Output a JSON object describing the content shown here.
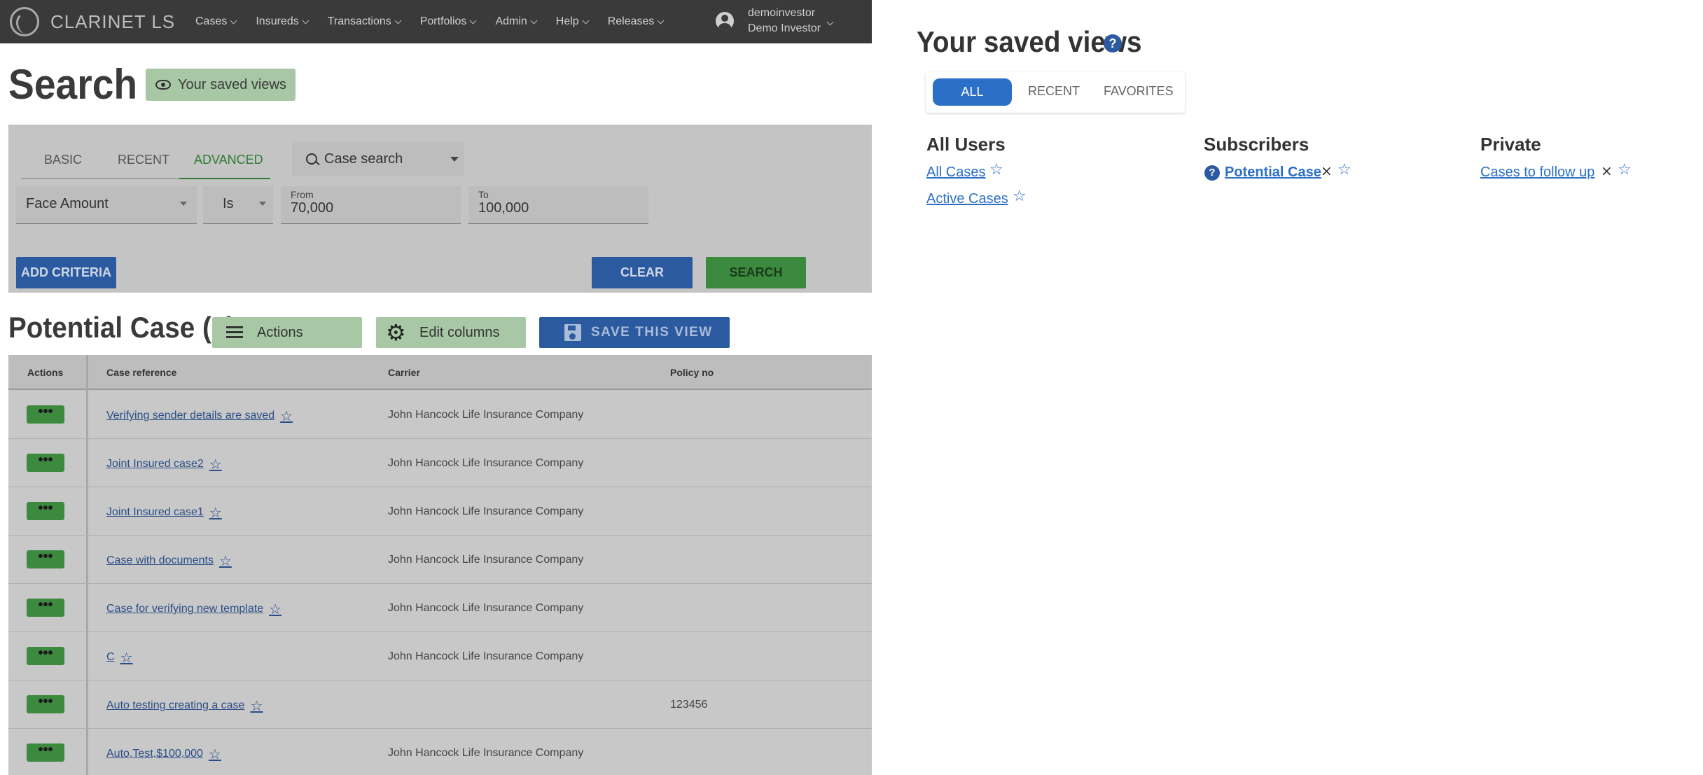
{
  "navbar": {
    "brand": "CLARINET LS",
    "items": [
      "Cases",
      "Insureds",
      "Transactions",
      "Portfolios",
      "Admin",
      "Help",
      "Releases"
    ],
    "user": {
      "username": "demoinvestor",
      "display_name": "Demo Investor"
    }
  },
  "search": {
    "title": "Search",
    "saved_views_label": "Your saved views",
    "tabs": [
      "BASIC",
      "RECENT",
      "ADVANCED"
    ],
    "case_search_label": "Case search",
    "criteria": {
      "field": "Face Amount",
      "operator": "Is",
      "from_label": "From",
      "from_value": "70,000",
      "to_label": "To",
      "to_value": "100,000"
    },
    "add_criteria_label": "ADD CRITERIA",
    "clear_label": "CLEAR",
    "search_label": "SEARCH"
  },
  "results": {
    "title": "Potential Case (8)",
    "actions_label": "Actions",
    "edit_columns_label": "Edit columns",
    "save_view_label": "SAVE THIS VIEW",
    "columns": [
      "Actions",
      "Case reference",
      "Carrier",
      "Policy no"
    ],
    "row_button": "•••",
    "rows": [
      {
        "ref": "Verifying sender details are saved",
        "carrier": "John Hancock Life Insurance Company",
        "policy": ""
      },
      {
        "ref": "Joint Insured case2",
        "carrier": "John Hancock Life Insurance Company",
        "policy": ""
      },
      {
        "ref": "Joint Insured case1",
        "carrier": "John Hancock Life Insurance Company",
        "policy": ""
      },
      {
        "ref": "Case with documents",
        "carrier": "John Hancock Life Insurance Company",
        "policy": ""
      },
      {
        "ref": "Case for verifying new template",
        "carrier": "John Hancock Life Insurance Company",
        "policy": ""
      },
      {
        "ref": "C",
        "carrier": "John Hancock Life Insurance Company",
        "policy": ""
      },
      {
        "ref": "Auto testing creating a case",
        "carrier": "",
        "policy": "123456"
      },
      {
        "ref": "Auto,Test,$100,000",
        "carrier": "John Hancock Life Insurance Company",
        "policy": ""
      }
    ]
  },
  "saved_views_panel": {
    "title": "Your saved views",
    "tabs": [
      "ALL",
      "RECENT",
      "FAVORITES"
    ],
    "columns": [
      {
        "heading": "All Users",
        "views": [
          "All Cases",
          "Active Cases"
        ]
      },
      {
        "heading": "Subscribers",
        "views": [
          "Potential Case"
        ]
      },
      {
        "heading": "Private",
        "views": [
          "Cases to follow up"
        ]
      }
    ]
  },
  "icons": {
    "star": "☆",
    "close": "×",
    "help": "?"
  },
  "colors": {
    "primary_blue": "#2c6fc9",
    "navbar": "#3a3a3a",
    "green": "#3b8a3e"
  }
}
